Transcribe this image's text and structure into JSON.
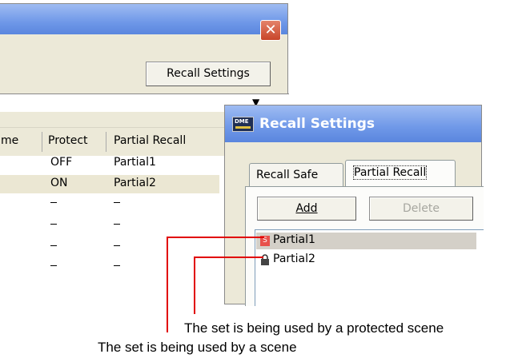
{
  "scene_window": {
    "close_glyph": "✕",
    "recall_settings_button": "Recall Settings",
    "dropdown_arrow": "▼",
    "columns": [
      "me",
      "Protect",
      "Partial Recall"
    ],
    "rows": [
      {
        "protect": "OFF",
        "partial": "Partial1"
      },
      {
        "protect": "ON",
        "partial": "Partial2"
      },
      {
        "protect": "–",
        "partial": "–"
      },
      {
        "protect": "–",
        "partial": "–"
      },
      {
        "protect": "–",
        "partial": "–"
      },
      {
        "protect": "–",
        "partial": "–"
      }
    ]
  },
  "recall_dialog": {
    "title": "Recall Settings",
    "app_icon_text": "DME",
    "tabs": [
      "Recall Safe",
      "Partial Recall"
    ],
    "add_button": "Add",
    "delete_button": "Delete",
    "items": [
      {
        "label": "Partial1",
        "badge": "S"
      },
      {
        "label": "Partial2",
        "badge": "lock-icon"
      }
    ]
  },
  "captions": {
    "protected": "The set is being used by a protected scene",
    "scene": "The set is being used by a scene"
  },
  "colors": {
    "title_bar": "#6f98e8",
    "scene_badge": "#e8514b",
    "leader_line": "#e10000",
    "selected_row": "#ebe7d3"
  }
}
